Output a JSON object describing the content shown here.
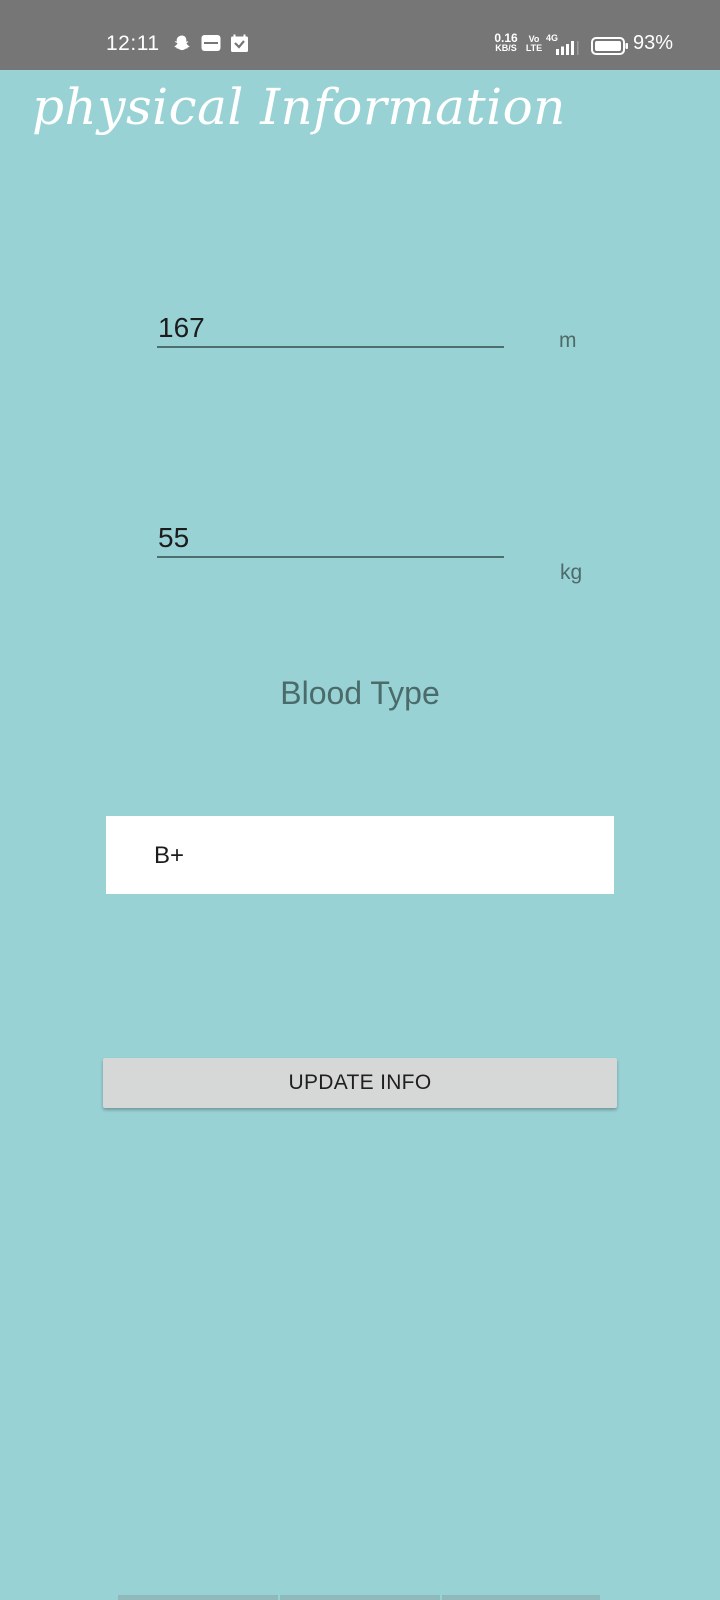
{
  "status_bar": {
    "time": "12:11",
    "net_speed_value": "0.16",
    "net_speed_unit": "KB/S",
    "volte_top": "Vo",
    "volte_bottom": "LTE",
    "network_type": "4G",
    "battery_percent": "93%",
    "icons": [
      "snapchat-icon",
      "app-notification-icon",
      "calendar-icon",
      "signal-icon",
      "battery-icon"
    ]
  },
  "page": {
    "title": "physical Information"
  },
  "form": {
    "height_value": "167",
    "height_unit": "m",
    "weight_value": "55",
    "weight_unit": "kg",
    "blood_type_label": "Blood Type",
    "blood_type_value": "B+",
    "update_button_label": "UPDATE INFO"
  },
  "colors": {
    "background": "#99d2d5",
    "status_bar": "#767676",
    "button": "#d6d7d7",
    "underline": "#4c6e6d"
  }
}
